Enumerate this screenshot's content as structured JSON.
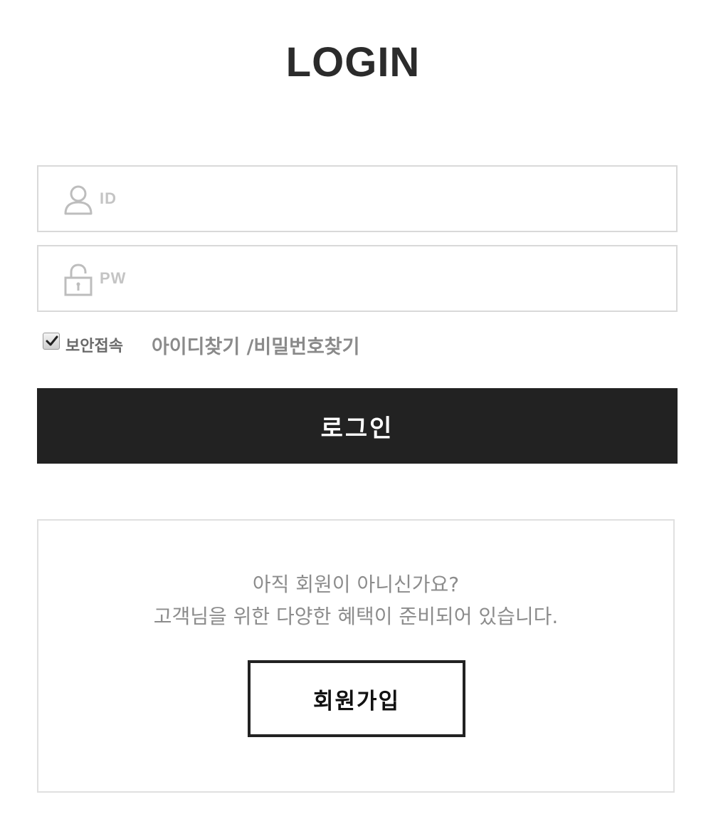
{
  "header": {
    "title": "LOGIN"
  },
  "form": {
    "id_placeholder": "ID",
    "pw_placeholder": "PW",
    "id_icon": "user-icon",
    "pw_icon": "lock-icon"
  },
  "options": {
    "secure_label": "보안접속",
    "secure_checked": true,
    "find_links": "아이디찾기 /비밀번호찾기"
  },
  "login_button": {
    "label": "로그인"
  },
  "join": {
    "line1": "아직 회원이 아니신가요?",
    "line2": "고객님을 위한 다양한 혜택이 준비되어 있습니다.",
    "button_label": "회원가입"
  },
  "colors": {
    "primary": "#222222",
    "border": "#d9d9d9",
    "muted_text": "#8c8c8c"
  }
}
